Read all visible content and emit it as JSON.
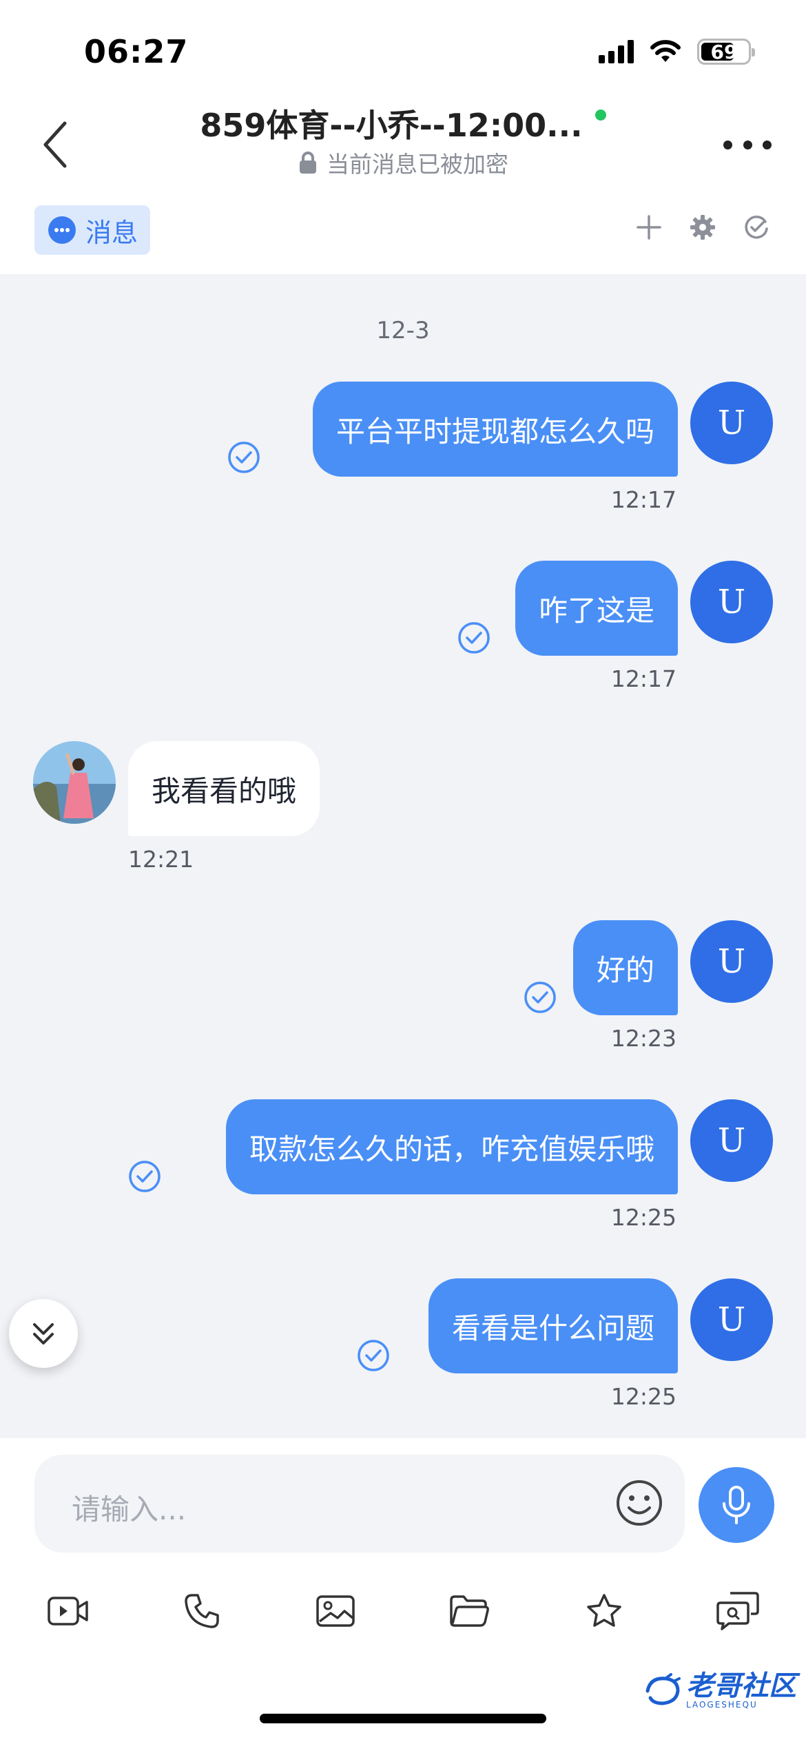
{
  "status_bar": {
    "time": "06:27",
    "battery": "69"
  },
  "header": {
    "title": "859体育--小乔--12:00...",
    "encryption_notice": "当前消息已被加密"
  },
  "tabs": {
    "message_label": "消息"
  },
  "chat": {
    "date": "12-3",
    "user_avatar_letter": "U",
    "messages": [
      {
        "direction": "out",
        "text": "平台平时提现都怎么久吗",
        "time": "12:17"
      },
      {
        "direction": "out",
        "text": "咋了这是",
        "time": "12:17"
      },
      {
        "direction": "in",
        "text": "我看看的哦",
        "time": "12:21"
      },
      {
        "direction": "out",
        "text": "好的",
        "time": "12:23"
      },
      {
        "direction": "out",
        "text": "取款怎么久的话，咋充值娱乐哦",
        "time": "12:25"
      },
      {
        "direction": "out",
        "text": "看看是什么问题",
        "time": "12:25"
      }
    ]
  },
  "composer": {
    "placeholder": "请输入..."
  },
  "toolbar": [
    "video-icon",
    "phone-icon",
    "image-icon",
    "folder-icon",
    "star-icon",
    "quick-reply-icon"
  ],
  "watermark": {
    "text": "老哥社区",
    "sub": "LAOGESHEQU"
  },
  "colors": {
    "accent": "#4a8ff6",
    "avatar": "#2f6ee6",
    "chat_bg": "#f1f3f7",
    "online": "#22c55e"
  }
}
